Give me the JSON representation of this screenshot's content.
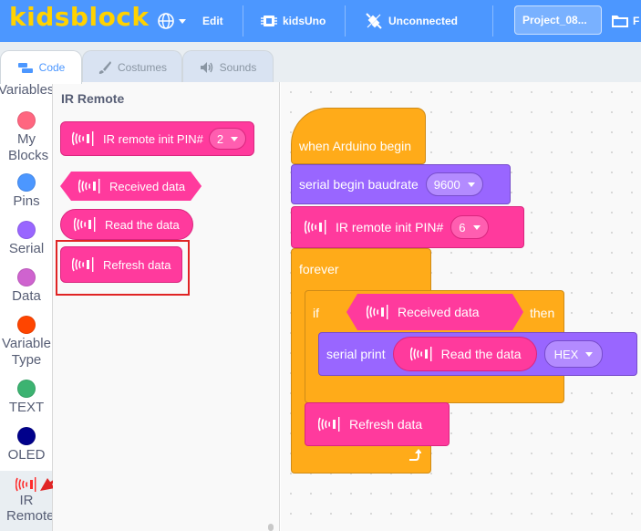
{
  "menu": {
    "logo": "kidsblock",
    "edit": "Edit",
    "device": "kidsUno",
    "connection": "Unconnected",
    "project": "Project_08...",
    "file_partial": "F"
  },
  "tabs": [
    {
      "label": "Code",
      "icon": "code-icon"
    },
    {
      "label": "Costumes",
      "icon": "brush-icon"
    },
    {
      "label": "Sounds",
      "icon": "speaker-icon"
    }
  ],
  "categories": [
    {
      "label": "Variables",
      "color": null
    },
    {
      "label": "My Blocks",
      "color": "#ff6680"
    },
    {
      "label": "Pins",
      "color": "#4c97ff"
    },
    {
      "label": "Serial",
      "color": "#9966ff"
    },
    {
      "label": "Data",
      "color": "#cf63cf"
    },
    {
      "label": "Variable Type",
      "color": "#ff4500"
    },
    {
      "label": "TEXT",
      "color": "#3cb371"
    },
    {
      "label": "OLED",
      "color": "#00008b"
    },
    {
      "label": "IR Remote",
      "color": "#ff2b2b"
    }
  ],
  "flyout": {
    "title": "IR Remote",
    "blocks": {
      "init": {
        "label": "IR remote init PIN#",
        "value": "2"
      },
      "received": {
        "label": "Received data"
      },
      "read": {
        "label": "Read the data"
      },
      "refresh": {
        "label": "Refresh data"
      }
    }
  },
  "script": {
    "hat": "when Arduino begin",
    "serial_begin": {
      "label": "serial begin baudrate",
      "value": "9600"
    },
    "ir_init": {
      "label": "IR remote init PIN#",
      "value": "6"
    },
    "forever": "forever",
    "if": "if",
    "received": "Received data",
    "then": "then",
    "serial_print": {
      "label": "serial print",
      "format": "HEX"
    },
    "read": "Read the data",
    "refresh": "Refresh data"
  },
  "colors": {
    "menubar": "#4c97ff",
    "ir_block": "#ff3a9d",
    "serial_block": "#9966ff",
    "control_block": "#ffab19",
    "highlight": "#e02424"
  }
}
